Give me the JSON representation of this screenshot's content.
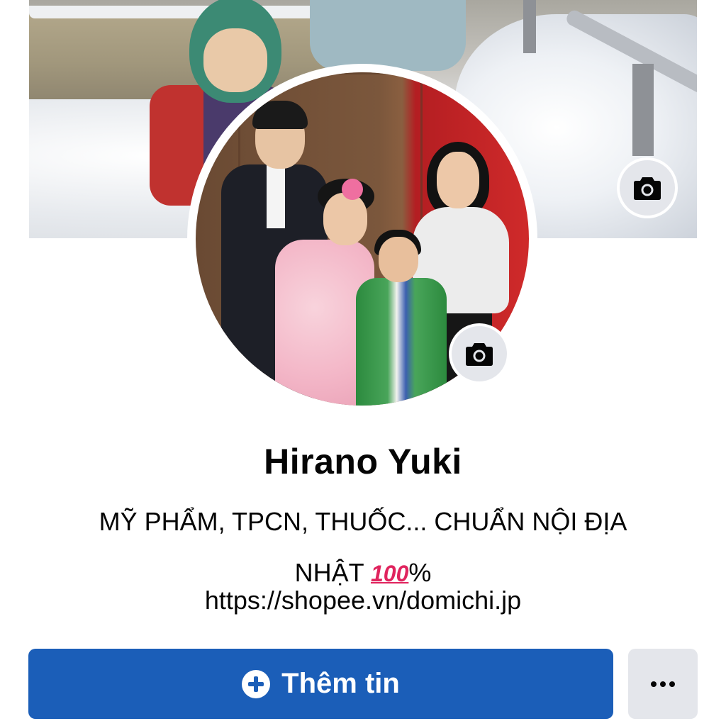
{
  "profile": {
    "name": "Hirano Yuki",
    "bio_line1": "MỸ PHẨM, TPCN, THUỐC... CHUẨN NỘI ĐỊA",
    "bio_line2_prefix": "NHẬT ",
    "bio_emoji": "100",
    "bio_line2_suffix": "%",
    "link": "https://shopee.vn/domichi.jp"
  },
  "actions": {
    "primary_label": "Thêm tin",
    "primary_icon": "plus-circle-icon",
    "more_icon": "more-horizontal-icon"
  },
  "photos": {
    "cover_camera_icon": "camera-icon",
    "avatar_camera_icon": "camera-icon"
  },
  "colors": {
    "primary_button": "#1b5eb8",
    "secondary_button": "#e4e6eb",
    "text": "#050505"
  }
}
